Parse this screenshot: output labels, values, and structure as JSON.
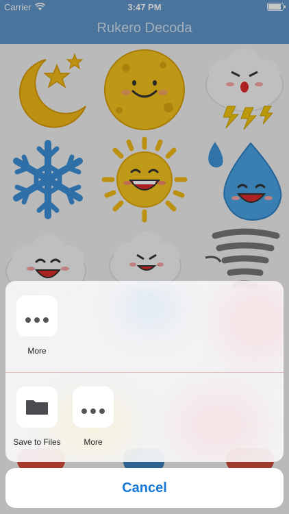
{
  "status_bar": {
    "carrier": "Carrier",
    "time": "3:47 PM",
    "battery_level": 0.9
  },
  "nav": {
    "title": "Rukero Decoda"
  },
  "stickers": [
    {
      "name": "crescent-moon-sticker"
    },
    {
      "name": "smiling-moon-sticker"
    },
    {
      "name": "angry-storm-cloud-sticker"
    },
    {
      "name": "snowflake-sticker"
    },
    {
      "name": "smiling-sun-sticker"
    },
    {
      "name": "raindrop-sticker"
    },
    {
      "name": "happy-cloud-sticker"
    },
    {
      "name": "angry-cloud-sticker"
    },
    {
      "name": "tornado-sticker"
    }
  ],
  "share_sheet": {
    "row1": [
      {
        "label": "More",
        "icon": "more-icon"
      }
    ],
    "row2": [
      {
        "label": "Save to Files",
        "icon": "folder-icon"
      },
      {
        "label": "More",
        "icon": "more-icon"
      }
    ],
    "cancel_label": "Cancel"
  },
  "colors": {
    "nav": "#5f95c8",
    "accent": "#1577d6"
  }
}
